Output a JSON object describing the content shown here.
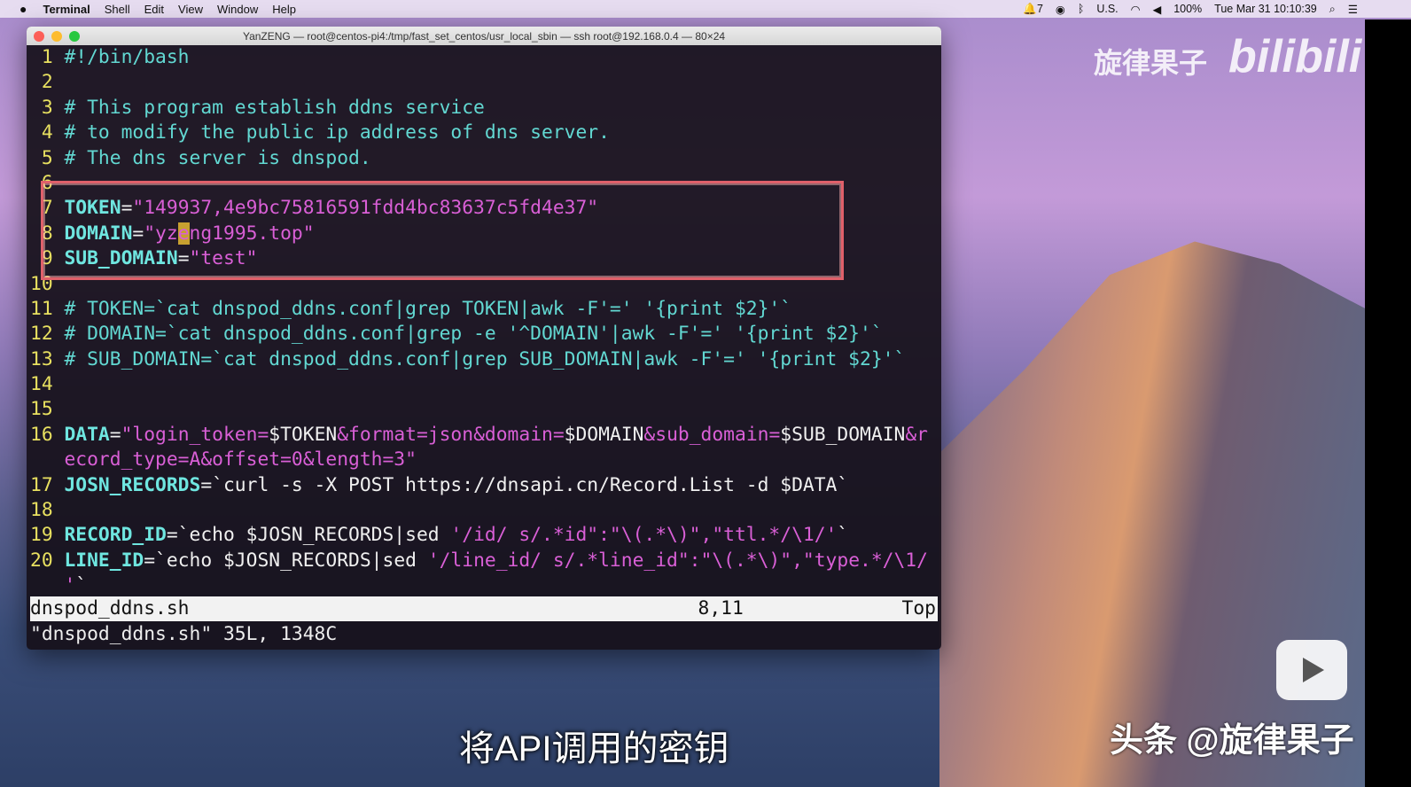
{
  "menubar": {
    "app": "Terminal",
    "items": [
      "Shell",
      "Edit",
      "View",
      "Window",
      "Help"
    ],
    "notifications": "7",
    "input_source": "U.S.",
    "battery": "100%",
    "clock": "Tue Mar 31  10:10:39"
  },
  "window": {
    "title": "YanZENG — root@centos-pi4:/tmp/fast_set_centos/usr_local_sbin — ssh root@192.168.0.4 — 80×24"
  },
  "lines": [
    [
      [
        "ln",
        " 1 "
      ],
      [
        "c",
        "#!/bin/bash"
      ]
    ],
    [
      [
        "ln",
        " 2 "
      ]
    ],
    [
      [
        "ln",
        " 3 "
      ],
      [
        "c",
        "# This program establish ddns service"
      ]
    ],
    [
      [
        "ln",
        " 4 "
      ],
      [
        "c",
        "# to modify the public ip address of dns server."
      ]
    ],
    [
      [
        "ln",
        " 5 "
      ],
      [
        "c",
        "# The dns server is dnspod."
      ]
    ],
    [
      [
        "ln",
        " 6 "
      ]
    ],
    [
      [
        "ln",
        " 7 "
      ],
      [
        "v",
        "TOKEN"
      ],
      [
        "w",
        "="
      ],
      [
        "s",
        "\"149937,4e9bc75816591fdd4bc83637c5fd4e37\""
      ]
    ],
    [
      [
        "ln",
        " 8 "
      ],
      [
        "v",
        "DOMAIN"
      ],
      [
        "w",
        "="
      ],
      [
        "s",
        "\"yz"
      ],
      [
        "cur",
        "e"
      ],
      [
        "s",
        "ng1995.top\""
      ]
    ],
    [
      [
        "ln",
        " 9 "
      ],
      [
        "v",
        "SUB_DOMAIN"
      ],
      [
        "w",
        "="
      ],
      [
        "s",
        "\"test\""
      ]
    ],
    [
      [
        "ln",
        "10 "
      ]
    ],
    [
      [
        "ln",
        "11 "
      ],
      [
        "c",
        "# TOKEN=`cat dnspod_ddns.conf|grep TOKEN|awk -F'=' '{print $2}'`"
      ]
    ],
    [
      [
        "ln",
        "12 "
      ],
      [
        "c",
        "# DOMAIN=`cat dnspod_ddns.conf|grep -e '^DOMAIN'|awk -F'=' '{print $2}'`"
      ]
    ],
    [
      [
        "ln",
        "13 "
      ],
      [
        "c",
        "# SUB_DOMAIN=`cat dnspod_ddns.conf|grep SUB_DOMAIN|awk -F'=' '{print $2}'`"
      ]
    ],
    [
      [
        "ln",
        "14 "
      ]
    ],
    [
      [
        "ln",
        "15 "
      ]
    ],
    [
      [
        "ln",
        "16 "
      ],
      [
        "v",
        "DATA"
      ],
      [
        "w",
        "="
      ],
      [
        "s",
        "\"login_token="
      ],
      [
        "w",
        "$TOKEN"
      ],
      [
        "s",
        "&format=json&domain="
      ],
      [
        "w",
        "$DOMAIN"
      ],
      [
        "s",
        "&sub_domain="
      ],
      [
        "w",
        "$SUB_DOMAIN"
      ],
      [
        "s",
        "&r"
      ]
    ],
    [
      [
        "ln",
        "   "
      ],
      [
        "s",
        "ecord_type=A&offset=0&length=3\""
      ]
    ],
    [
      [
        "ln",
        "17 "
      ],
      [
        "v",
        "JOSN_RECORDS"
      ],
      [
        "w",
        "=`curl -s -X POST https://dnsapi.cn/Record.List -d $DATA`"
      ]
    ],
    [
      [
        "ln",
        "18 "
      ]
    ],
    [
      [
        "ln",
        "19 "
      ],
      [
        "v",
        "RECORD_ID"
      ],
      [
        "w",
        "=`echo $JOSN_RECORDS|sed "
      ],
      [
        "s",
        "'/id/ s/.*id\":\"\\(.*\\)\",\"ttl.*/\\1/'"
      ],
      [
        "w",
        "`"
      ]
    ],
    [
      [
        "ln",
        "20 "
      ],
      [
        "v",
        "LINE_ID"
      ],
      [
        "w",
        "=`echo $JOSN_RECORDS|sed "
      ],
      [
        "s",
        "'/line_id/ s/.*line_id\":\"\\(.*\\)\",\"type.*/\\1/"
      ]
    ],
    [
      [
        "ln",
        "   "
      ],
      [
        "s",
        "'"
      ],
      [
        "w",
        "`"
      ]
    ]
  ],
  "status": {
    "filename": "dnspod_ddns.sh",
    "position": "8,11",
    "scroll": "Top",
    "message": "\"dnspod_ddns.sh\" 35L, 1348C"
  },
  "overlay": {
    "watermark": "旋律果子",
    "brand": "bilibili",
    "subtitle": "将API调用的密钥",
    "credit": "头条 @旋律果子"
  }
}
